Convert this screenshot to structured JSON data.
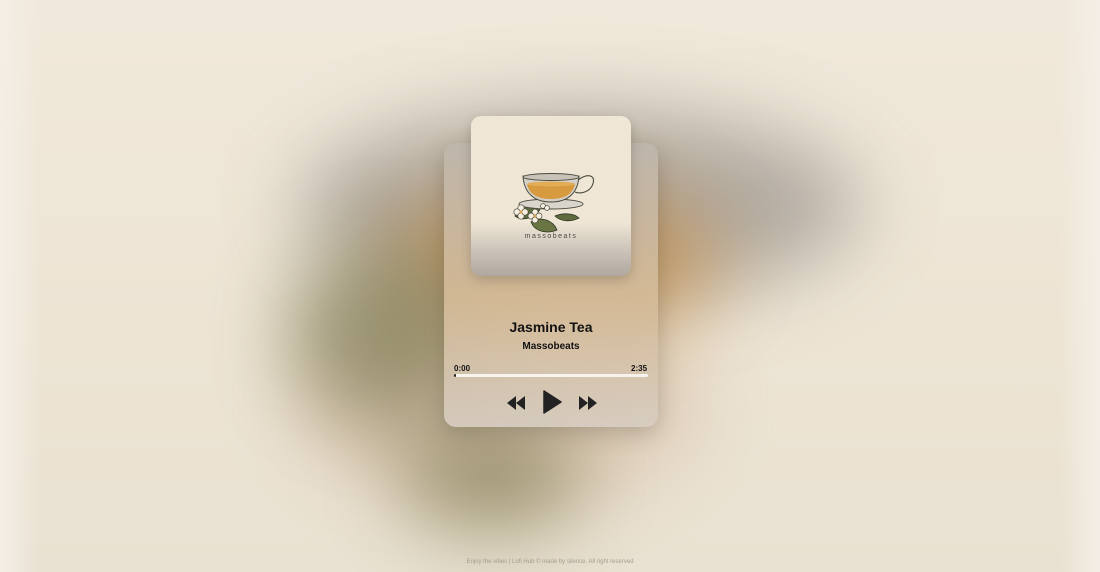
{
  "background": {
    "base": "#efe7d8",
    "accent_orange": "#c99046",
    "accent_olive": "#6f6b3e"
  },
  "cover": {
    "brand_text": "massobeats",
    "art_icon": "teacup-with-jasmine-flowers"
  },
  "track": {
    "title": "Jasmine Tea",
    "artist": "Massobeats"
  },
  "progress": {
    "current_time": "0:00",
    "duration": "2:35",
    "fraction": 0
  },
  "controls": {
    "rewind_icon": "rewind-icon",
    "play_icon": "play-icon",
    "forward_icon": "fast-forward-icon"
  },
  "footer": {
    "text": "Enjoy the vibes | Lofi Hub © made by silence. All right reserved"
  }
}
